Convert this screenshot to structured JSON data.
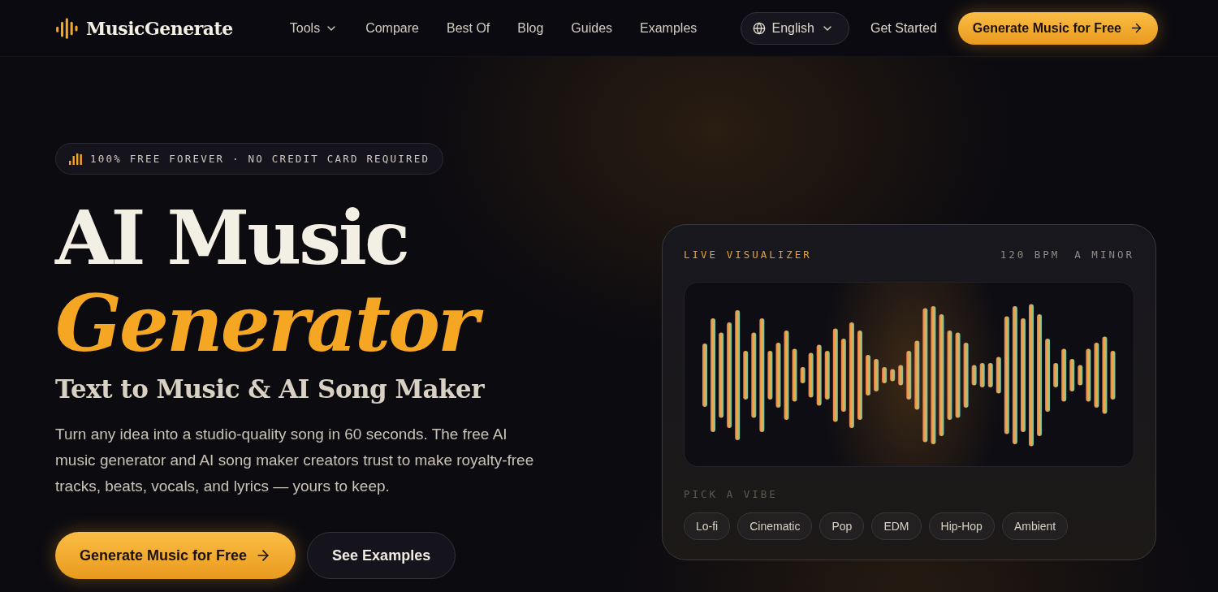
{
  "nav": {
    "logo": "MusicGenerate",
    "links": [
      {
        "label": "Tools",
        "dropdown": true
      },
      {
        "label": "Compare",
        "dropdown": false
      },
      {
        "label": "Best Of",
        "dropdown": false
      },
      {
        "label": "Blog",
        "dropdown": false
      },
      {
        "label": "Guides",
        "dropdown": false
      },
      {
        "label": "Examples",
        "dropdown": false
      }
    ],
    "language": "English",
    "secondary_action": "Get Started",
    "primary_action": "Generate Music for Free"
  },
  "hero": {
    "badge": "100% FREE FOREVER · NO CREDIT CARD REQUIRED",
    "title_line": "AI Music",
    "title_accent": "Generator",
    "subtitle": "Text to Music & AI Song Maker",
    "description": "Turn any idea into a studio-quality song in 60 seconds. The free AI music generator and AI song maker creators trust to make royalty-free tracks, beats, vocals, and lyrics — yours to keep.",
    "primary_button": "Generate Music for Free",
    "secondary_button": "See Examples"
  },
  "visualizer": {
    "label": "LIVE VISUALIZER",
    "tempo": "120 BPM",
    "key": "A MINOR",
    "vibe_label": "PICK A VIBE",
    "vibes": [
      "Lo-fi",
      "Cinematic",
      "Pop",
      "EDM",
      "Hip-Hop",
      "Ambient"
    ]
  }
}
